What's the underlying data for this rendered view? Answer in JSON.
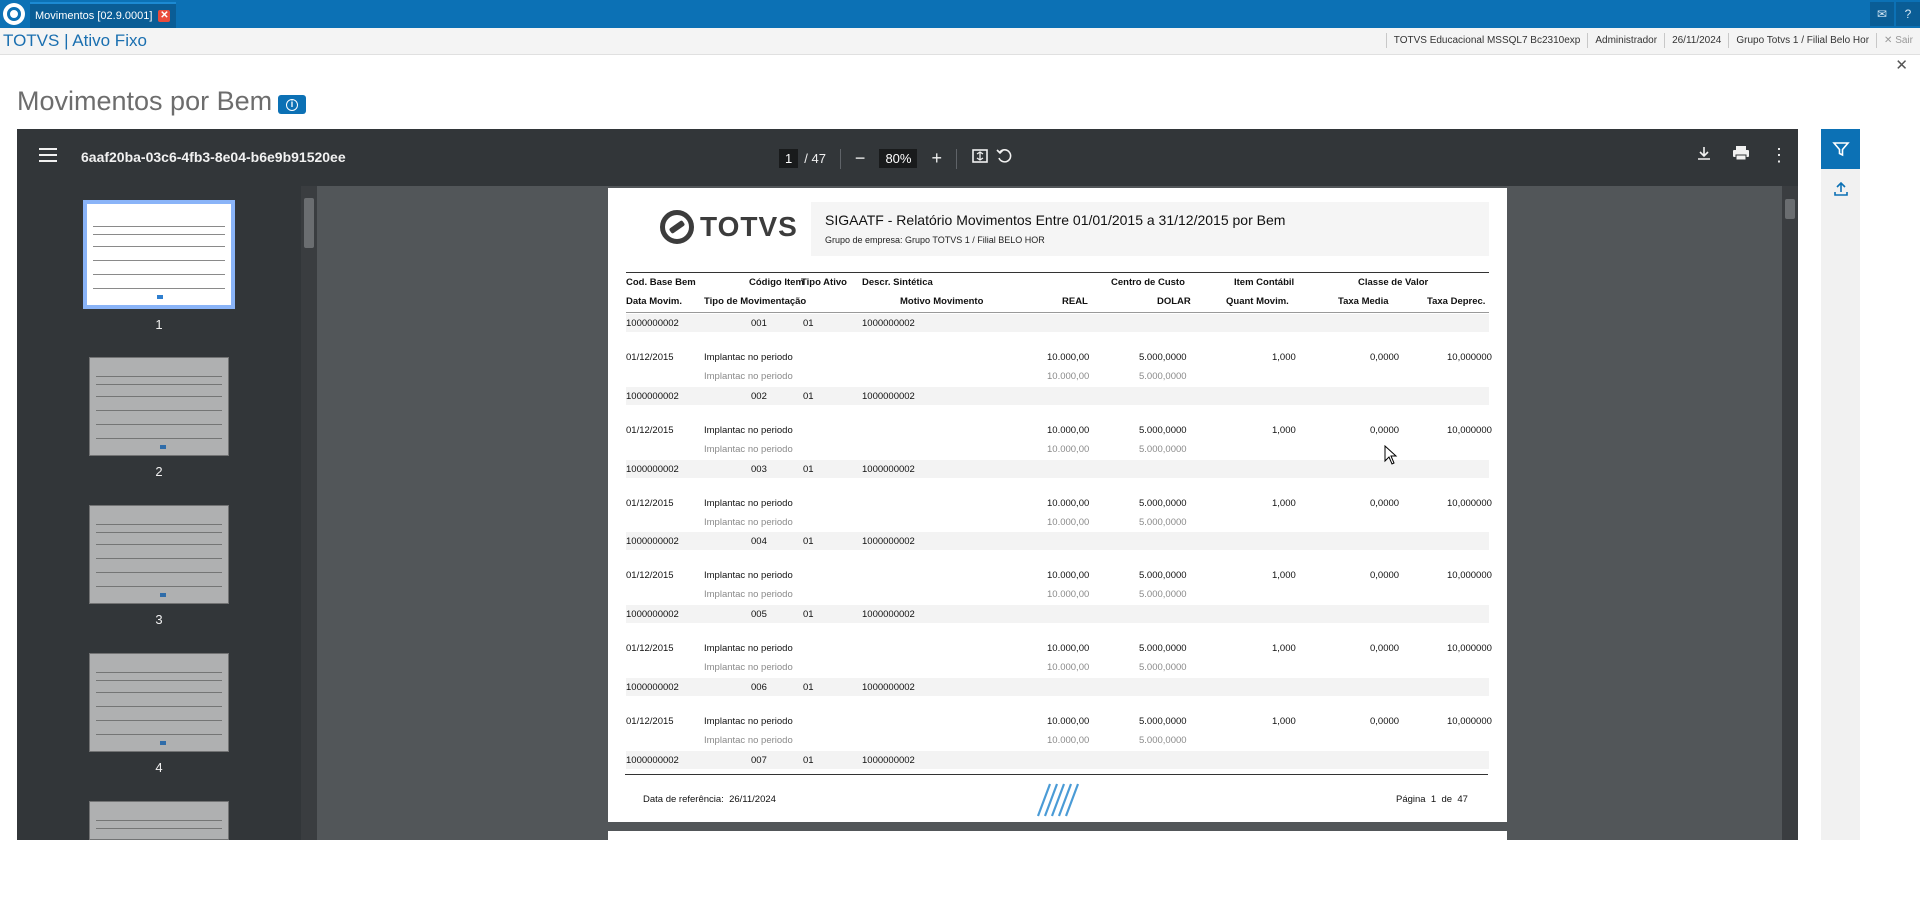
{
  "tab": {
    "title": "Movimentos [02.9.0001]"
  },
  "header": {
    "app_title": "TOTVS | Ativo Fixo",
    "env": "TOTVS Educacional MSSQL7 Bc2310exp",
    "user": "Administrador",
    "date": "26/11/2024",
    "branch": "Grupo Totvs 1 / Filial Belo Hor",
    "exit_label": "Sair"
  },
  "page": {
    "title": "Movimentos por Bem"
  },
  "viewer": {
    "filename": "6aaf20ba-03c6-4fb3-8e04-b6e9b91520ee",
    "current_page": "1",
    "total_pages": "/ 47",
    "zoom": "80%",
    "thumbnails": [
      "1",
      "2",
      "3",
      "4"
    ]
  },
  "report": {
    "logo": "TOTVS",
    "title": "SIGAATF - Relatório Movimentos Entre 01/01/2015 a 31/12/2015 por Bem",
    "subtitle": "Grupo de empresa: Grupo TOTVS 1 / Filial BELO HOR",
    "headers_row1": [
      "Cod. Base Bem",
      "Código Item",
      "Tipo Ativo",
      "Descr. Sintética",
      "Centro de Custo",
      "Item Contábil",
      "Classe de Valor"
    ],
    "headers_row2": [
      "Data Movim.",
      "Tipo de Movimentação",
      "Motivo Movimento",
      "REAL",
      "DOLAR",
      "Quant Movim.",
      "Taxa Media",
      "Taxa Deprec."
    ],
    "groups": [
      {
        "base": "1000000002",
        "item": "001",
        "tipo": "01",
        "descr": "1000000002"
      },
      {
        "base": "1000000002",
        "item": "002",
        "tipo": "01",
        "descr": "1000000002"
      },
      {
        "base": "1000000002",
        "item": "003",
        "tipo": "01",
        "descr": "1000000002"
      },
      {
        "base": "1000000002",
        "item": "004",
        "tipo": "01",
        "descr": "1000000002"
      },
      {
        "base": "1000000002",
        "item": "005",
        "tipo": "01",
        "descr": "1000000002"
      },
      {
        "base": "1000000002",
        "item": "006",
        "tipo": "01",
        "descr": "1000000002"
      },
      {
        "base": "1000000002",
        "item": "007",
        "tipo": "01",
        "descr": "1000000002"
      }
    ],
    "movement": {
      "date": "01/12/2015",
      "type": "Implantac no periodo",
      "real": "10.000,00",
      "dolar": "5.000,0000",
      "qty": "1,000",
      "taxa_media": "0,0000",
      "taxa_deprec": "10,000000"
    },
    "footer": {
      "ref_label": "Data de referência:",
      "ref_date": "26/11/2024",
      "page_label": "Página",
      "page_num": "1",
      "of_label": "de",
      "page_total": "47"
    }
  }
}
